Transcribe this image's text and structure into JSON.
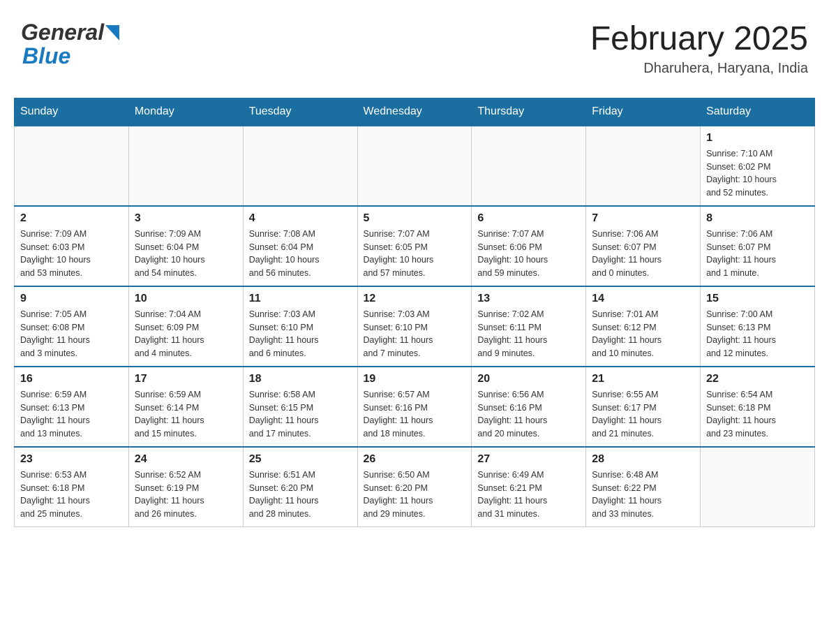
{
  "header": {
    "logo_line1": "General",
    "logo_line2": "Blue",
    "month_title": "February 2025",
    "location": "Dharuhera, Haryana, India"
  },
  "weekdays": [
    "Sunday",
    "Monday",
    "Tuesday",
    "Wednesday",
    "Thursday",
    "Friday",
    "Saturday"
  ],
  "weeks": [
    {
      "cells": [
        {
          "day": "",
          "info": ""
        },
        {
          "day": "",
          "info": ""
        },
        {
          "day": "",
          "info": ""
        },
        {
          "day": "",
          "info": ""
        },
        {
          "day": "",
          "info": ""
        },
        {
          "day": "",
          "info": ""
        },
        {
          "day": "1",
          "info": "Sunrise: 7:10 AM\nSunset: 6:02 PM\nDaylight: 10 hours\nand 52 minutes."
        }
      ]
    },
    {
      "cells": [
        {
          "day": "2",
          "info": "Sunrise: 7:09 AM\nSunset: 6:03 PM\nDaylight: 10 hours\nand 53 minutes."
        },
        {
          "day": "3",
          "info": "Sunrise: 7:09 AM\nSunset: 6:04 PM\nDaylight: 10 hours\nand 54 minutes."
        },
        {
          "day": "4",
          "info": "Sunrise: 7:08 AM\nSunset: 6:04 PM\nDaylight: 10 hours\nand 56 minutes."
        },
        {
          "day": "5",
          "info": "Sunrise: 7:07 AM\nSunset: 6:05 PM\nDaylight: 10 hours\nand 57 minutes."
        },
        {
          "day": "6",
          "info": "Sunrise: 7:07 AM\nSunset: 6:06 PM\nDaylight: 10 hours\nand 59 minutes."
        },
        {
          "day": "7",
          "info": "Sunrise: 7:06 AM\nSunset: 6:07 PM\nDaylight: 11 hours\nand 0 minutes."
        },
        {
          "day": "8",
          "info": "Sunrise: 7:06 AM\nSunset: 6:07 PM\nDaylight: 11 hours\nand 1 minute."
        }
      ]
    },
    {
      "cells": [
        {
          "day": "9",
          "info": "Sunrise: 7:05 AM\nSunset: 6:08 PM\nDaylight: 11 hours\nand 3 minutes."
        },
        {
          "day": "10",
          "info": "Sunrise: 7:04 AM\nSunset: 6:09 PM\nDaylight: 11 hours\nand 4 minutes."
        },
        {
          "day": "11",
          "info": "Sunrise: 7:03 AM\nSunset: 6:10 PM\nDaylight: 11 hours\nand 6 minutes."
        },
        {
          "day": "12",
          "info": "Sunrise: 7:03 AM\nSunset: 6:10 PM\nDaylight: 11 hours\nand 7 minutes."
        },
        {
          "day": "13",
          "info": "Sunrise: 7:02 AM\nSunset: 6:11 PM\nDaylight: 11 hours\nand 9 minutes."
        },
        {
          "day": "14",
          "info": "Sunrise: 7:01 AM\nSunset: 6:12 PM\nDaylight: 11 hours\nand 10 minutes."
        },
        {
          "day": "15",
          "info": "Sunrise: 7:00 AM\nSunset: 6:13 PM\nDaylight: 11 hours\nand 12 minutes."
        }
      ]
    },
    {
      "cells": [
        {
          "day": "16",
          "info": "Sunrise: 6:59 AM\nSunset: 6:13 PM\nDaylight: 11 hours\nand 13 minutes."
        },
        {
          "day": "17",
          "info": "Sunrise: 6:59 AM\nSunset: 6:14 PM\nDaylight: 11 hours\nand 15 minutes."
        },
        {
          "day": "18",
          "info": "Sunrise: 6:58 AM\nSunset: 6:15 PM\nDaylight: 11 hours\nand 17 minutes."
        },
        {
          "day": "19",
          "info": "Sunrise: 6:57 AM\nSunset: 6:16 PM\nDaylight: 11 hours\nand 18 minutes."
        },
        {
          "day": "20",
          "info": "Sunrise: 6:56 AM\nSunset: 6:16 PM\nDaylight: 11 hours\nand 20 minutes."
        },
        {
          "day": "21",
          "info": "Sunrise: 6:55 AM\nSunset: 6:17 PM\nDaylight: 11 hours\nand 21 minutes."
        },
        {
          "day": "22",
          "info": "Sunrise: 6:54 AM\nSunset: 6:18 PM\nDaylight: 11 hours\nand 23 minutes."
        }
      ]
    },
    {
      "cells": [
        {
          "day": "23",
          "info": "Sunrise: 6:53 AM\nSunset: 6:18 PM\nDaylight: 11 hours\nand 25 minutes."
        },
        {
          "day": "24",
          "info": "Sunrise: 6:52 AM\nSunset: 6:19 PM\nDaylight: 11 hours\nand 26 minutes."
        },
        {
          "day": "25",
          "info": "Sunrise: 6:51 AM\nSunset: 6:20 PM\nDaylight: 11 hours\nand 28 minutes."
        },
        {
          "day": "26",
          "info": "Sunrise: 6:50 AM\nSunset: 6:20 PM\nDaylight: 11 hours\nand 29 minutes."
        },
        {
          "day": "27",
          "info": "Sunrise: 6:49 AM\nSunset: 6:21 PM\nDaylight: 11 hours\nand 31 minutes."
        },
        {
          "day": "28",
          "info": "Sunrise: 6:48 AM\nSunset: 6:22 PM\nDaylight: 11 hours\nand 33 minutes."
        },
        {
          "day": "",
          "info": ""
        }
      ]
    }
  ]
}
